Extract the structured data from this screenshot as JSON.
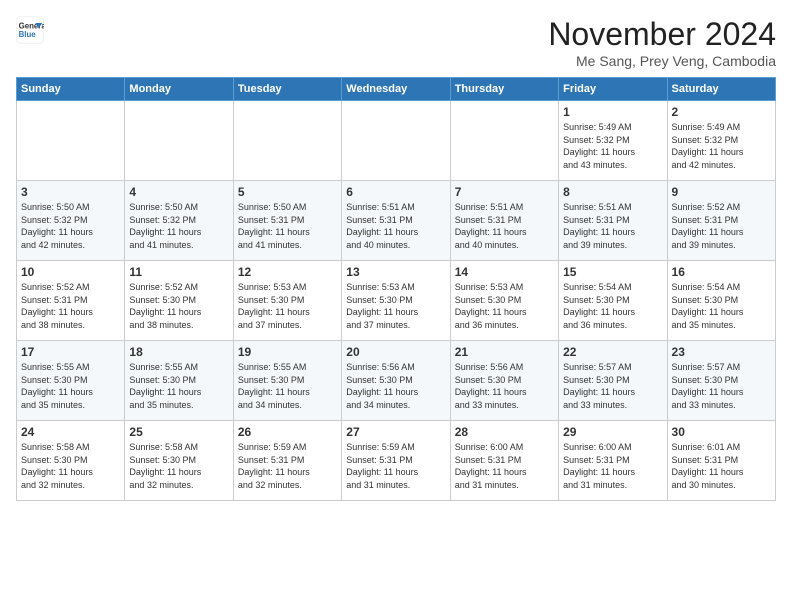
{
  "header": {
    "logo_line1": "General",
    "logo_line2": "Blue",
    "month_year": "November 2024",
    "location": "Me Sang, Prey Veng, Cambodia"
  },
  "weekdays": [
    "Sunday",
    "Monday",
    "Tuesday",
    "Wednesday",
    "Thursday",
    "Friday",
    "Saturday"
  ],
  "weeks": [
    [
      {
        "day": "",
        "info": ""
      },
      {
        "day": "",
        "info": ""
      },
      {
        "day": "",
        "info": ""
      },
      {
        "day": "",
        "info": ""
      },
      {
        "day": "",
        "info": ""
      },
      {
        "day": "1",
        "info": "Sunrise: 5:49 AM\nSunset: 5:32 PM\nDaylight: 11 hours\nand 43 minutes."
      },
      {
        "day": "2",
        "info": "Sunrise: 5:49 AM\nSunset: 5:32 PM\nDaylight: 11 hours\nand 42 minutes."
      }
    ],
    [
      {
        "day": "3",
        "info": "Sunrise: 5:50 AM\nSunset: 5:32 PM\nDaylight: 11 hours\nand 42 minutes."
      },
      {
        "day": "4",
        "info": "Sunrise: 5:50 AM\nSunset: 5:32 PM\nDaylight: 11 hours\nand 41 minutes."
      },
      {
        "day": "5",
        "info": "Sunrise: 5:50 AM\nSunset: 5:31 PM\nDaylight: 11 hours\nand 41 minutes."
      },
      {
        "day": "6",
        "info": "Sunrise: 5:51 AM\nSunset: 5:31 PM\nDaylight: 11 hours\nand 40 minutes."
      },
      {
        "day": "7",
        "info": "Sunrise: 5:51 AM\nSunset: 5:31 PM\nDaylight: 11 hours\nand 40 minutes."
      },
      {
        "day": "8",
        "info": "Sunrise: 5:51 AM\nSunset: 5:31 PM\nDaylight: 11 hours\nand 39 minutes."
      },
      {
        "day": "9",
        "info": "Sunrise: 5:52 AM\nSunset: 5:31 PM\nDaylight: 11 hours\nand 39 minutes."
      }
    ],
    [
      {
        "day": "10",
        "info": "Sunrise: 5:52 AM\nSunset: 5:31 PM\nDaylight: 11 hours\nand 38 minutes."
      },
      {
        "day": "11",
        "info": "Sunrise: 5:52 AM\nSunset: 5:30 PM\nDaylight: 11 hours\nand 38 minutes."
      },
      {
        "day": "12",
        "info": "Sunrise: 5:53 AM\nSunset: 5:30 PM\nDaylight: 11 hours\nand 37 minutes."
      },
      {
        "day": "13",
        "info": "Sunrise: 5:53 AM\nSunset: 5:30 PM\nDaylight: 11 hours\nand 37 minutes."
      },
      {
        "day": "14",
        "info": "Sunrise: 5:53 AM\nSunset: 5:30 PM\nDaylight: 11 hours\nand 36 minutes."
      },
      {
        "day": "15",
        "info": "Sunrise: 5:54 AM\nSunset: 5:30 PM\nDaylight: 11 hours\nand 36 minutes."
      },
      {
        "day": "16",
        "info": "Sunrise: 5:54 AM\nSunset: 5:30 PM\nDaylight: 11 hours\nand 35 minutes."
      }
    ],
    [
      {
        "day": "17",
        "info": "Sunrise: 5:55 AM\nSunset: 5:30 PM\nDaylight: 11 hours\nand 35 minutes."
      },
      {
        "day": "18",
        "info": "Sunrise: 5:55 AM\nSunset: 5:30 PM\nDaylight: 11 hours\nand 35 minutes."
      },
      {
        "day": "19",
        "info": "Sunrise: 5:55 AM\nSunset: 5:30 PM\nDaylight: 11 hours\nand 34 minutes."
      },
      {
        "day": "20",
        "info": "Sunrise: 5:56 AM\nSunset: 5:30 PM\nDaylight: 11 hours\nand 34 minutes."
      },
      {
        "day": "21",
        "info": "Sunrise: 5:56 AM\nSunset: 5:30 PM\nDaylight: 11 hours\nand 33 minutes."
      },
      {
        "day": "22",
        "info": "Sunrise: 5:57 AM\nSunset: 5:30 PM\nDaylight: 11 hours\nand 33 minutes."
      },
      {
        "day": "23",
        "info": "Sunrise: 5:57 AM\nSunset: 5:30 PM\nDaylight: 11 hours\nand 33 minutes."
      }
    ],
    [
      {
        "day": "24",
        "info": "Sunrise: 5:58 AM\nSunset: 5:30 PM\nDaylight: 11 hours\nand 32 minutes."
      },
      {
        "day": "25",
        "info": "Sunrise: 5:58 AM\nSunset: 5:30 PM\nDaylight: 11 hours\nand 32 minutes."
      },
      {
        "day": "26",
        "info": "Sunrise: 5:59 AM\nSunset: 5:31 PM\nDaylight: 11 hours\nand 32 minutes."
      },
      {
        "day": "27",
        "info": "Sunrise: 5:59 AM\nSunset: 5:31 PM\nDaylight: 11 hours\nand 31 minutes."
      },
      {
        "day": "28",
        "info": "Sunrise: 6:00 AM\nSunset: 5:31 PM\nDaylight: 11 hours\nand 31 minutes."
      },
      {
        "day": "29",
        "info": "Sunrise: 6:00 AM\nSunset: 5:31 PM\nDaylight: 11 hours\nand 31 minutes."
      },
      {
        "day": "30",
        "info": "Sunrise: 6:01 AM\nSunset: 5:31 PM\nDaylight: 11 hours\nand 30 minutes."
      }
    ]
  ]
}
